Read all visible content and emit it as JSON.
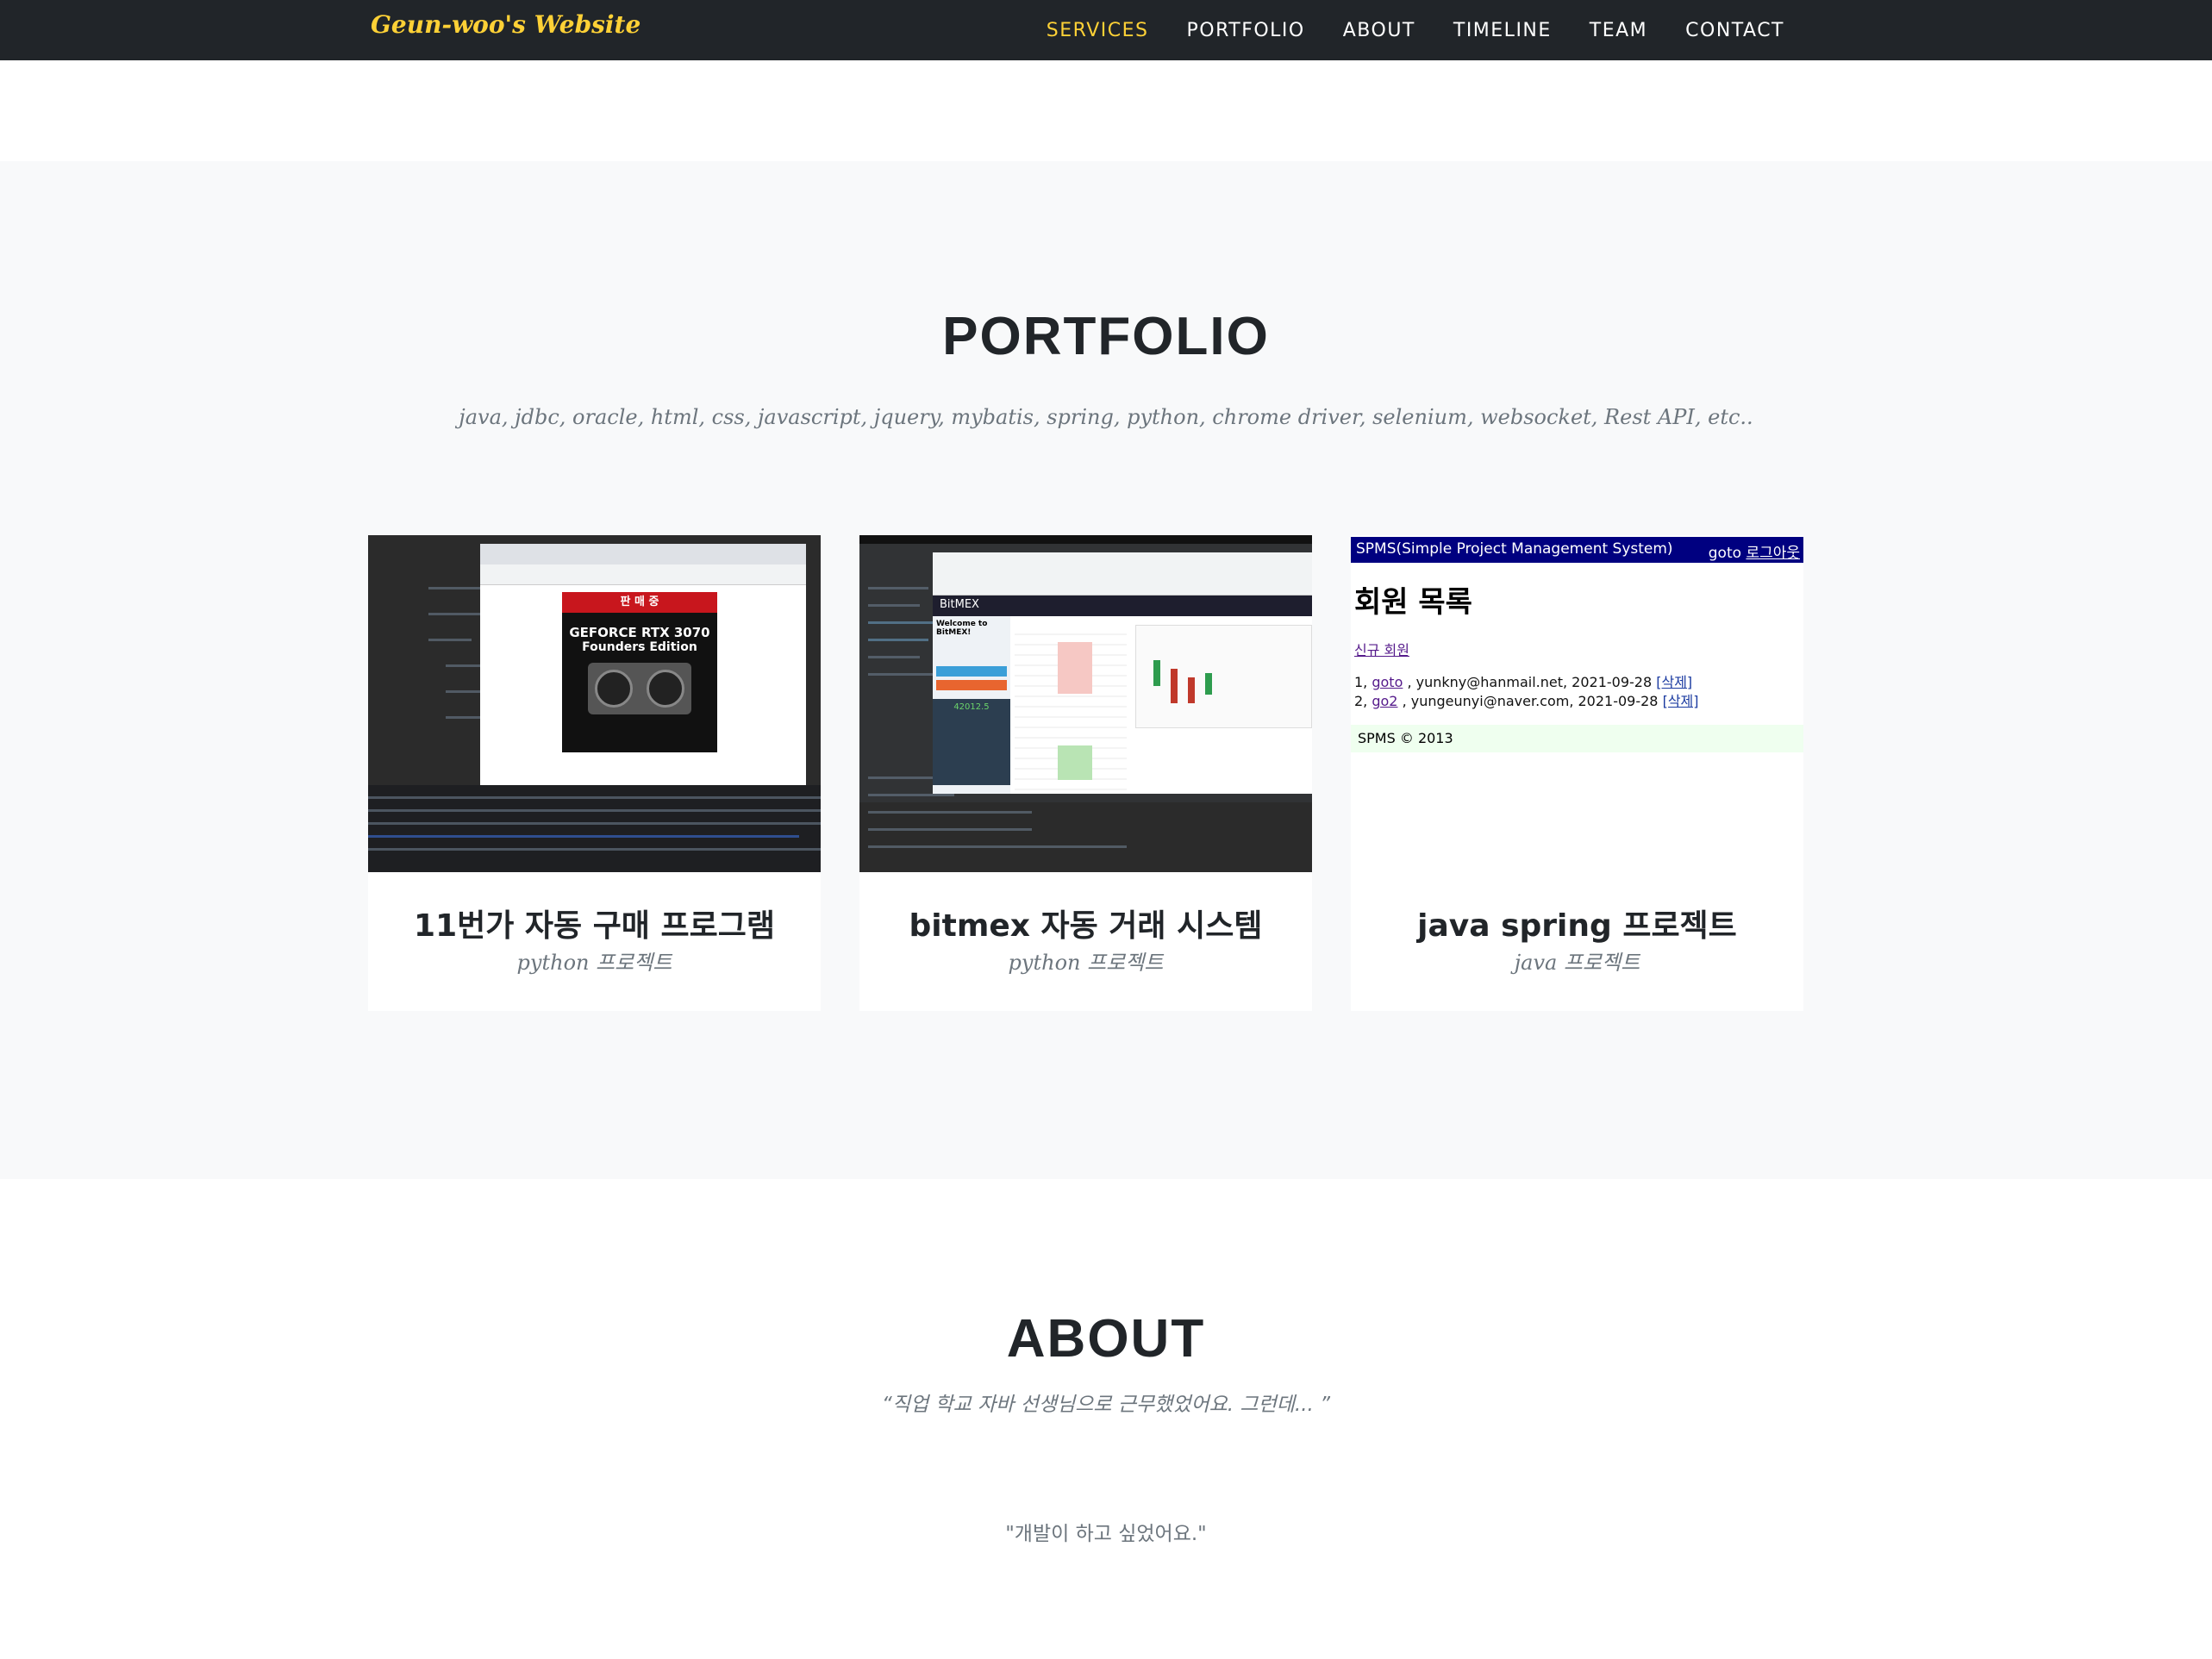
{
  "nav": {
    "brand": "Geun-woo's Website",
    "items": [
      {
        "label": "SERVICES",
        "active": true
      },
      {
        "label": "PORTFOLIO"
      },
      {
        "label": "ABOUT"
      },
      {
        "label": "TIMELINE"
      },
      {
        "label": "TEAM"
      },
      {
        "label": "CONTACT"
      }
    ]
  },
  "portfolio": {
    "heading": "PORTFOLIO",
    "subheading": "java, jdbc, oracle, html, css, javascript, jquery, mybatis, spring, python, chrome driver, selenium, websocket, Rest API, etc..",
    "items": [
      {
        "title": "11번가 자동 구매 프로그램",
        "subtitle": "python 프로젝트",
        "thumb": {
          "banner": "판 매 중",
          "product": "GEFORCE RTX 3070",
          "edition": "Founders Edition"
        }
      },
      {
        "title": "bitmex 자동 거래 시스템",
        "subtitle": "python 프로젝트",
        "thumb": {
          "logo": "BitMEX",
          "welcome": "Welcome to BitMEX!",
          "price": "42012.5"
        }
      },
      {
        "title": "java spring 프로젝트",
        "subtitle": "java 프로젝트",
        "thumb": {
          "bar_title": "SPMS(Simple Project Management System)",
          "user": "goto",
          "logout": "로그아웃",
          "heading": "회원 목록",
          "new_member": "신규 회원",
          "rows": [
            {
              "no": "1,",
              "name": "goto",
              "info": ", yunkny@hanmail.net, 2021-09-28",
              "del": "[삭제]"
            },
            {
              "no": "2,",
              "name": "go2",
              "info": ", yungeunyi@naver.com, 2021-09-28",
              "del": "[삭제]"
            }
          ],
          "footer": "SPMS © 2013"
        }
      }
    ]
  },
  "about": {
    "heading": "ABOUT",
    "quote": "“직업 학교 자바 선생님으로 근무했었어요. 그런데... ”",
    "quote2": "\"개발이 하고 싶었어요.\""
  },
  "colors": {
    "nav_bg": "#212529",
    "accent": "#fed136",
    "section_bg": "#f8f9fa"
  }
}
